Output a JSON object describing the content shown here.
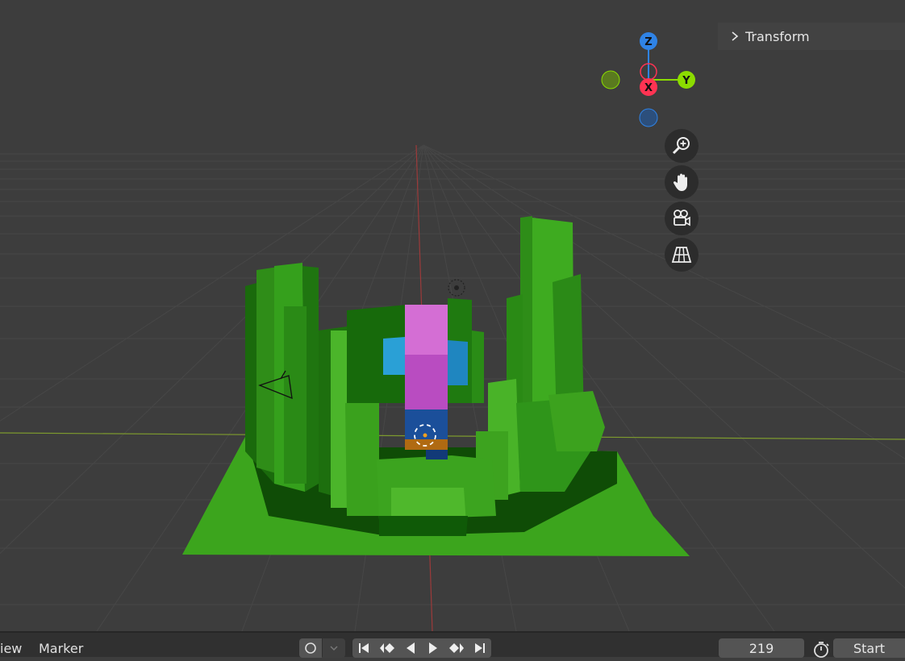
{
  "viewport": {
    "transform_panel_label": "Transform",
    "gizmo": {
      "x_label": "X",
      "y_label": "Y",
      "z_label": "Z"
    },
    "nav_buttons": [
      "zoom-icon",
      "hand-pan-icon",
      "camera-view-icon",
      "perspective-grid-icon"
    ],
    "colors": {
      "background": "#3d3d3d",
      "axis_x": "#ff3352",
      "axis_y": "#8bdc00",
      "axis_z": "#2f83e6",
      "terrain": "#3a9e1c"
    }
  },
  "timeline": {
    "view_menu": "iew",
    "marker_menu": "Marker",
    "current_frame": "219",
    "start_label": "Start",
    "playback_buttons": [
      "jump-start-icon",
      "prev-keyframe-icon",
      "play-reverse-icon",
      "play-icon",
      "next-keyframe-icon",
      "jump-end-icon"
    ]
  }
}
